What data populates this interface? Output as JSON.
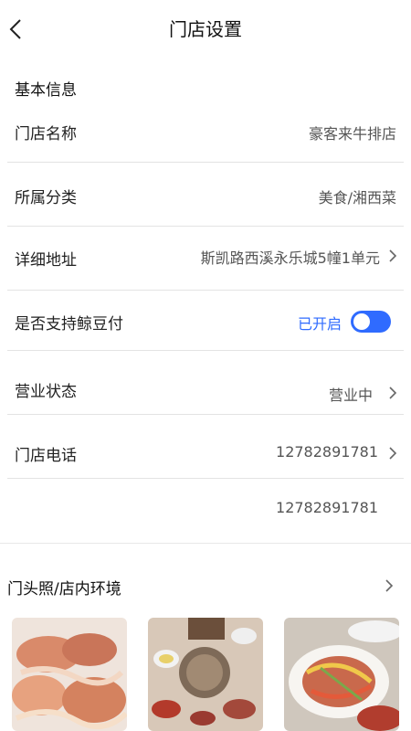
{
  "header": {
    "title": "门店设置"
  },
  "section_basic": "基本信息",
  "rows": {
    "store_name": {
      "label": "门店名称",
      "value": "豪客来牛排店"
    },
    "category": {
      "label": "所属分类",
      "value": "美食/湘西菜"
    },
    "address": {
      "label": "详细地址",
      "value": "斯凯路西溪永乐城5幢1单元"
    },
    "jingdou_pay": {
      "label": "是否支持鲸豆付",
      "value": "已开启",
      "enabled": true
    },
    "business_status": {
      "label": "营业状态",
      "value": "营业中"
    },
    "phone": {
      "label": "门店电话",
      "value": "12782891781"
    },
    "phone2": {
      "value": "12782891781"
    }
  },
  "photos_section": {
    "title": "门头照/店内环境"
  },
  "colors": {
    "accent": "#2f6bff",
    "divider": "#e3e3e3"
  },
  "icons": [
    "back-arrow-icon",
    "chevron-right-icon",
    "toggle-switch"
  ]
}
